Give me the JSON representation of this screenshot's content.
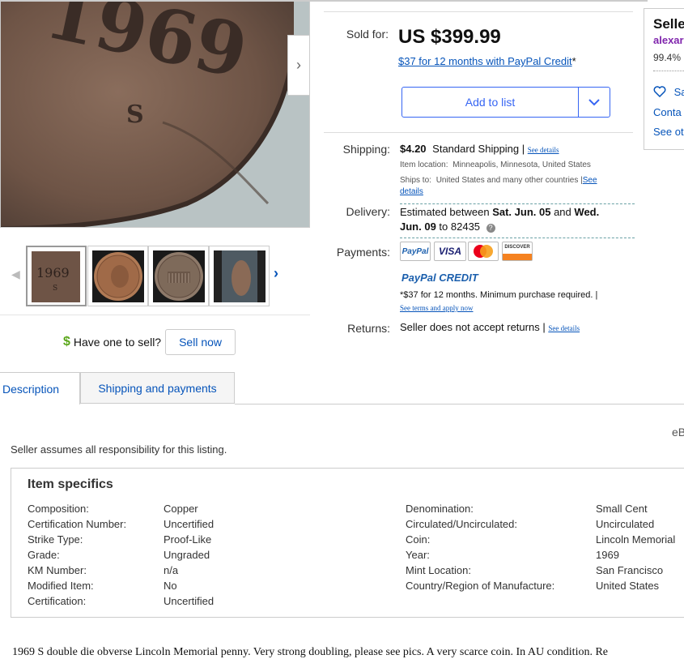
{
  "gallery": {
    "thumb_year": "1969",
    "thumb_mint": "S"
  },
  "sell": {
    "dollar_icon": "$",
    "prompt": "Have one to sell?",
    "button": "Sell now"
  },
  "purchase": {
    "sold_label": "Sold for:",
    "price": "US $399.99",
    "paypal_offer": "$37 for 12 months with PayPal Credit",
    "paypal_offer_suffix": "*",
    "add_to_list": "Add to list"
  },
  "shipping": {
    "label": "Shipping:",
    "cost": "$4.20",
    "service": "Standard Shipping |",
    "see_details": "See details",
    "item_location_label": "Item location:",
    "item_location": "Minneapolis, Minnesota, United States",
    "ships_to_label": "Ships to:",
    "ships_to": "United States and many other countries |",
    "ships_to_see": "See",
    "ships_to_details": "details"
  },
  "delivery": {
    "label": "Delivery:",
    "estimated_prefix": "Estimated between",
    "start": "Sat. Jun. 05",
    "and": "and",
    "end_part1": "Wed.",
    "end_part2": "Jun. 09",
    "to": "to",
    "zip": "82435",
    "info_icon": "?"
  },
  "payments": {
    "label": "Payments:",
    "methods": [
      "PayPal",
      "VISA",
      "mastercard",
      "DISCOVER"
    ],
    "paypal_credit": "PayPal CREDIT",
    "credit_note": "*$37 for 12 months. Minimum purchase required.  |",
    "see_terms": "See terms and apply now"
  },
  "returns": {
    "label": "Returns:",
    "text": "Seller does not accept returns |",
    "see_details": "See details"
  },
  "seller": {
    "title": "Selle",
    "name": "alexar",
    "feedback": "99.4%",
    "save": "Sa",
    "contact": "Conta",
    "see_other": "See ot"
  },
  "tabs": {
    "description": "Description",
    "shipping_payments": "Shipping and payments"
  },
  "listing": {
    "ebay_id_fragment": "eB",
    "seller_responsibility": "Seller assumes all responsibility for this listing."
  },
  "specifics": {
    "title": "Item specifics",
    "left": [
      {
        "label": "Composition:",
        "value": "Copper"
      },
      {
        "label": "Certification Number:",
        "value": "Uncertified"
      },
      {
        "label": "Strike Type:",
        "value": "Proof-Like"
      },
      {
        "label": "Grade:",
        "value": "Ungraded"
      },
      {
        "label": "KM Number:",
        "value": "n/a"
      },
      {
        "label": "Modified Item:",
        "value": "No"
      },
      {
        "label": "Certification:",
        "value": "Uncertified"
      }
    ],
    "right": [
      {
        "label": "Denomination:",
        "value": "Small Cent"
      },
      {
        "label": "Circulated/Uncirculated:",
        "value": "Uncirculated"
      },
      {
        "label": "Coin:",
        "value": "Lincoln Memorial"
      },
      {
        "label": "Year:",
        "value": "1969"
      },
      {
        "label": "Mint Location:",
        "value": "San Francisco"
      },
      {
        "label": "Country/Region of Manufacture:",
        "value": "United States"
      }
    ]
  },
  "description": {
    "text": "1969 S double die obverse Lincoln Memorial penny. Very strong doubling, please see pics. A very scarce coin. In AU condition. Re"
  },
  "colors": {
    "link": "#0654ba",
    "button_blue": "#3665f3",
    "coin_copper": "#7a5a48"
  }
}
